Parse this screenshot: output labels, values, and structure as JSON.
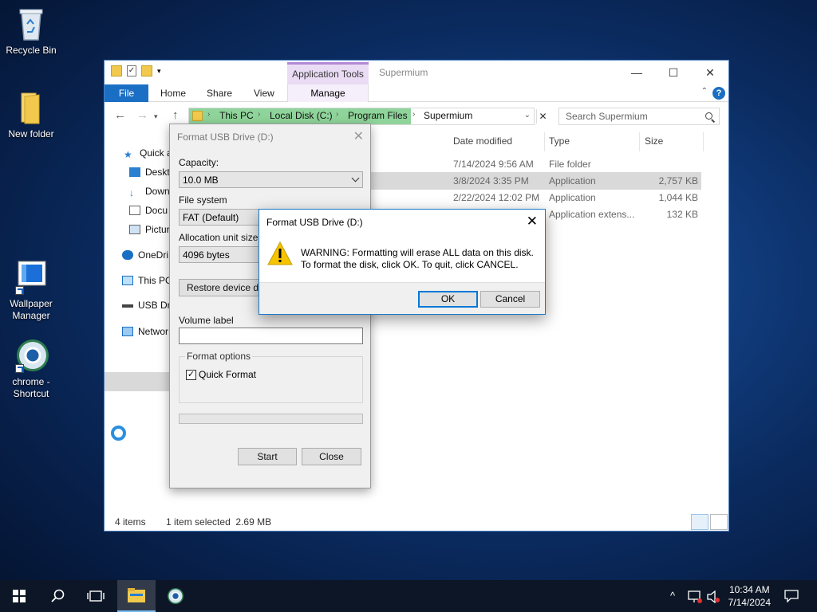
{
  "desktop": {
    "icons": [
      {
        "label": "Recycle Bin"
      },
      {
        "label": "New folder"
      },
      {
        "label": "Wallpaper Manager"
      },
      {
        "label": "chrome - Shortcut"
      }
    ]
  },
  "explorer": {
    "context_tab": "Application Tools",
    "window_title": "Supermium",
    "tabs": {
      "file": "File",
      "home": "Home",
      "share": "Share",
      "view": "View",
      "manage": "Manage"
    },
    "breadcrumb": [
      "This PC",
      "Local Disk (C:)",
      "Program Files",
      "Supermium"
    ],
    "search_placeholder": "Search Supermium",
    "nav": [
      "Quick a",
      "Deskt",
      "Down",
      "Docu",
      "Pictur",
      "OneDri",
      "This PC",
      "USB Dri",
      "Networ"
    ],
    "columns": {
      "date": "Date modified",
      "type": "Type",
      "size": "Size"
    },
    "rows": [
      {
        "date": "7/14/2024 9:56 AM",
        "type": "File folder",
        "size": ""
      },
      {
        "date": "3/8/2024 3:35 PM",
        "type": "Application",
        "size": "2,757 KB"
      },
      {
        "date": "2/22/2024 12:02 PM",
        "type": "Application",
        "size": "1,044 KB"
      },
      {
        "date": "",
        "type": "Application extens...",
        "size": "132 KB"
      }
    ],
    "status": {
      "count": "4 items",
      "selected": "1 item selected  2.69 MB"
    }
  },
  "format_dialog": {
    "title": "Format USB Drive (D:)",
    "capacity_label": "Capacity:",
    "capacity_value": "10.0 MB",
    "filesystem_label": "File system",
    "filesystem_value": "FAT (Default)",
    "alloc_label": "Allocation unit size",
    "alloc_value": "4096 bytes",
    "restore_label": "Restore device def",
    "volume_label": "Volume label",
    "options_label": "Format options",
    "quick_format_label": "Quick Format",
    "start_label": "Start",
    "close_label": "Close"
  },
  "warning_dialog": {
    "title": "Format USB Drive (D:)",
    "line1": "WARNING: Formatting will erase ALL data on this disk.",
    "line2": "To format the disk, click OK. To quit, click CANCEL.",
    "ok_label": "OK",
    "cancel_label": "Cancel"
  },
  "taskbar": {
    "time": "10:34 AM",
    "date": "7/14/2024"
  }
}
